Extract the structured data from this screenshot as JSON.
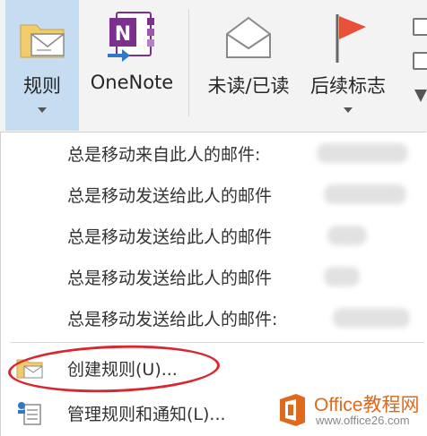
{
  "ribbon": {
    "rules_label": "规则",
    "onenote_label": "OneNote",
    "unread_label": "未读/已读",
    "followup_label": "后续标志"
  },
  "menu": {
    "items": [
      {
        "label": "总是移动来自此人的邮件:"
      },
      {
        "label": "总是移动发送给此人的邮件"
      },
      {
        "label": "总是移动发送给此人的邮件"
      },
      {
        "label": "总是移动发送给此人的邮件"
      },
      {
        "label": "总是移动发送给此人的邮件:"
      }
    ],
    "create_rule_label": "创建规则(U)...",
    "manage_rules_label": "管理规则和通知(L)..."
  },
  "watermark": {
    "brand": "Office教程网",
    "site": "www.office26.com"
  },
  "colors": {
    "rules_selected_bg": "#c6dcf1",
    "onenote_purple": "#7b2f8e",
    "flag_red": "#e8503a",
    "highlight_oval": "#d8282f",
    "watermark_orange": "#e06a1b"
  }
}
